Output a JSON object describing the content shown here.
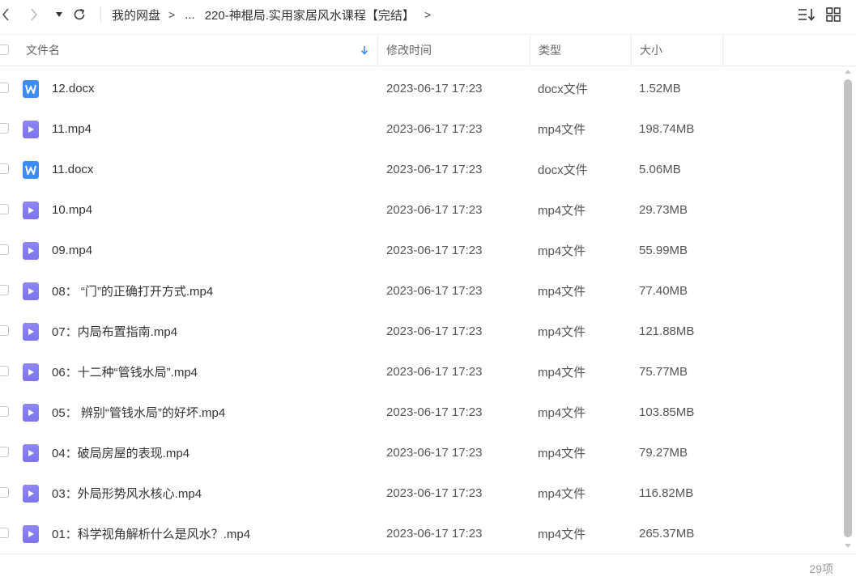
{
  "toolbar": {
    "back_icon": "chevron-left-icon",
    "forward_icon": "chevron-right-icon",
    "history_icon": "caret-down-icon",
    "refresh_icon": "refresh-icon",
    "sort_icon": "sort-list-icon",
    "grid_icon": "grid-view-icon"
  },
  "breadcrumb": {
    "root": "我的网盘",
    "sep": ">",
    "ellipsis": "...",
    "current": "220-神棍局.实用家居风水课程【完结】"
  },
  "header": {
    "name": "文件名",
    "modified": "修改时间",
    "type": "类型",
    "size": "大小",
    "sort_indicator": "down-arrow-icon"
  },
  "colors": {
    "docx_icon": "#3b8cf5",
    "mp4_icon": "#8e87f4",
    "sort_arrow": "#3b8cf5"
  },
  "files": [
    {
      "name": "12.docx",
      "modified": "2023-06-17 17:23",
      "type": "docx文件",
      "size": "1.52MB",
      "kind": "docx"
    },
    {
      "name": "11.mp4",
      "modified": "2023-06-17 17:23",
      "type": "mp4文件",
      "size": "198.74MB",
      "kind": "mp4"
    },
    {
      "name": "11.docx",
      "modified": "2023-06-17 17:23",
      "type": "docx文件",
      "size": "5.06MB",
      "kind": "docx"
    },
    {
      "name": "10.mp4",
      "modified": "2023-06-17 17:23",
      "type": "mp4文件",
      "size": "29.73MB",
      "kind": "mp4"
    },
    {
      "name": "09.mp4",
      "modified": "2023-06-17 17:23",
      "type": "mp4文件",
      "size": "55.99MB",
      "kind": "mp4"
    },
    {
      "name": "08： “门”的正确打开方式.mp4",
      "modified": "2023-06-17 17:23",
      "type": "mp4文件",
      "size": "77.40MB",
      "kind": "mp4"
    },
    {
      "name": "07：内局布置指南.mp4",
      "modified": "2023-06-17 17:23",
      "type": "mp4文件",
      "size": "121.88MB",
      "kind": "mp4"
    },
    {
      "name": "06：十二种“管钱水局”.mp4",
      "modified": "2023-06-17 17:23",
      "type": "mp4文件",
      "size": "75.77MB",
      "kind": "mp4"
    },
    {
      "name": "05： 辨别“管钱水局”的好坏.mp4",
      "modified": "2023-06-17 17:23",
      "type": "mp4文件",
      "size": "103.85MB",
      "kind": "mp4"
    },
    {
      "name": "04：破局房屋的表现.mp4",
      "modified": "2023-06-17 17:23",
      "type": "mp4文件",
      "size": "79.27MB",
      "kind": "mp4"
    },
    {
      "name": "03：外局形势风水核心.mp4",
      "modified": "2023-06-17 17:23",
      "type": "mp4文件",
      "size": "116.82MB",
      "kind": "mp4"
    },
    {
      "name": "01：科学视角解析什么是风水？.mp4",
      "modified": "2023-06-17 17:23",
      "type": "mp4文件",
      "size": "265.37MB",
      "kind": "mp4"
    }
  ],
  "footer": {
    "count": "29项"
  }
}
